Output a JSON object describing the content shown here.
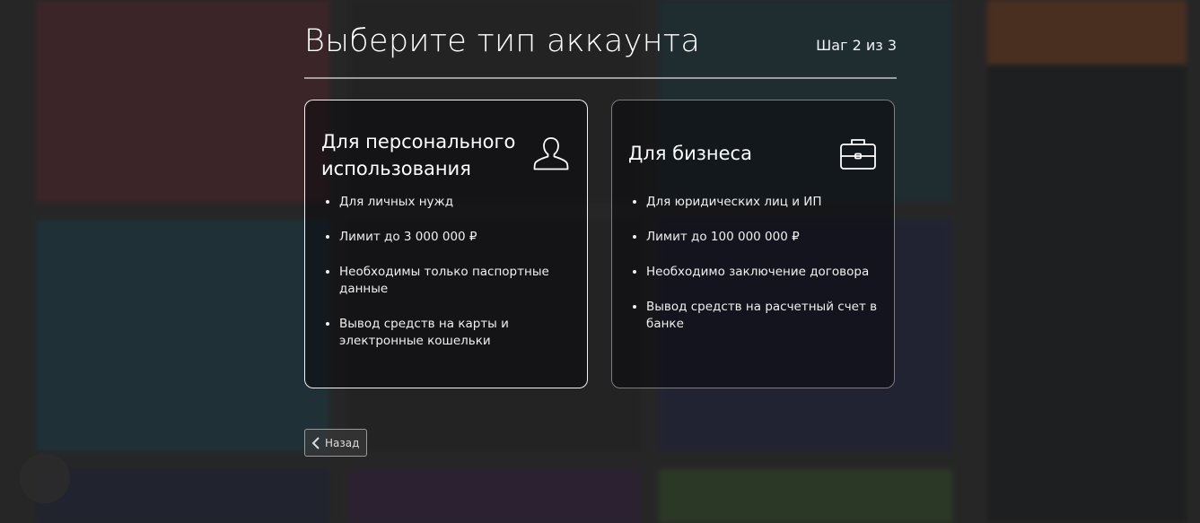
{
  "modal": {
    "title": "Выберите тип аккаунта",
    "step": "Шаг 2 из 3",
    "cards": [
      {
        "title": "Для персонального использования",
        "icon": "user-icon",
        "features": [
          "Для личных нужд",
          "Лимит до 3 000 000 ₽",
          "Необходимы только паспортные данные",
          "Вывод средств на карты и электронные кошельки"
        ]
      },
      {
        "title": "Для бизнеса",
        "icon": "briefcase-icon",
        "features": [
          "Для юридических лиц и ИП",
          "Лимит до 100 000 000 ₽",
          "Необходимо заключение договора",
          "Вывод средств на расчетный счет в банке"
        ]
      }
    ],
    "back_label": "Назад"
  },
  "colors": {
    "tile_red": "#c0334a",
    "tile_teal": "#0e7aa0",
    "tile_dark": "#2a2a2a",
    "tile_blue": "#1f2a8c",
    "tile_purple": "#5a1f80",
    "tile_green": "#5aa63a",
    "tile_orange": "#e8722a",
    "sidebar": "#1d1f22"
  }
}
